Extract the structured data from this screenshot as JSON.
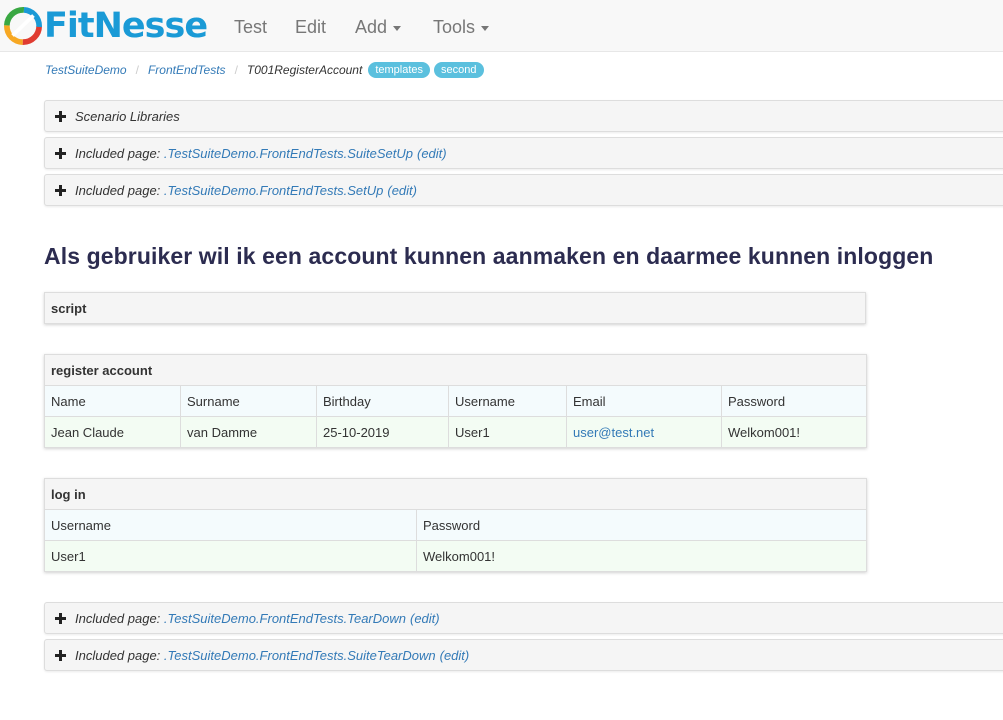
{
  "navbar": {
    "brand": "FitNesse",
    "menu": [
      "Test",
      "Edit",
      "Add",
      "Tools"
    ]
  },
  "breadcrumb": {
    "items": [
      "TestSuiteDemo",
      "FrontEndTests"
    ],
    "current": "T001RegisterAccount",
    "tags": [
      "templates",
      "second"
    ]
  },
  "sections_top": [
    {
      "prefix": "Scenario Libraries",
      "link": "",
      "edit": ""
    },
    {
      "prefix": "Included page:",
      "link": ".TestSuiteDemo.FrontEndTests.SuiteSetUp",
      "edit": "(edit)"
    },
    {
      "prefix": "Included page:",
      "link": ".TestSuiteDemo.FrontEndTests.SetUp",
      "edit": "(edit)"
    }
  ],
  "page_title": "Als gebruiker wil ik een account kunnen aanmaken en daarmee kunnen inloggen",
  "script_table": {
    "title": "script"
  },
  "register_table": {
    "title": "register account",
    "columns": [
      "Name",
      "Surname",
      "Birthday",
      "Username",
      "Email",
      "Password"
    ],
    "row": [
      "Jean Claude",
      "van Damme",
      "25-10-2019",
      "User1",
      "user@test.net",
      "Welkom001!"
    ]
  },
  "login_table": {
    "title": "log in",
    "columns": [
      "Username",
      "Password"
    ],
    "row": [
      "User1",
      "Welkom001!"
    ]
  },
  "sections_bottom": [
    {
      "prefix": "Included page:",
      "link": ".TestSuiteDemo.FrontEndTests.TearDown",
      "edit": "(edit)"
    },
    {
      "prefix": "Included page:",
      "link": ".TestSuiteDemo.FrontEndTests.SuiteTearDown",
      "edit": "(edit)"
    }
  ],
  "colors": {
    "brand": "#1a9ad6",
    "link": "#337ab7",
    "tag": "#5bc0de",
    "heading": "#2c2c50"
  }
}
